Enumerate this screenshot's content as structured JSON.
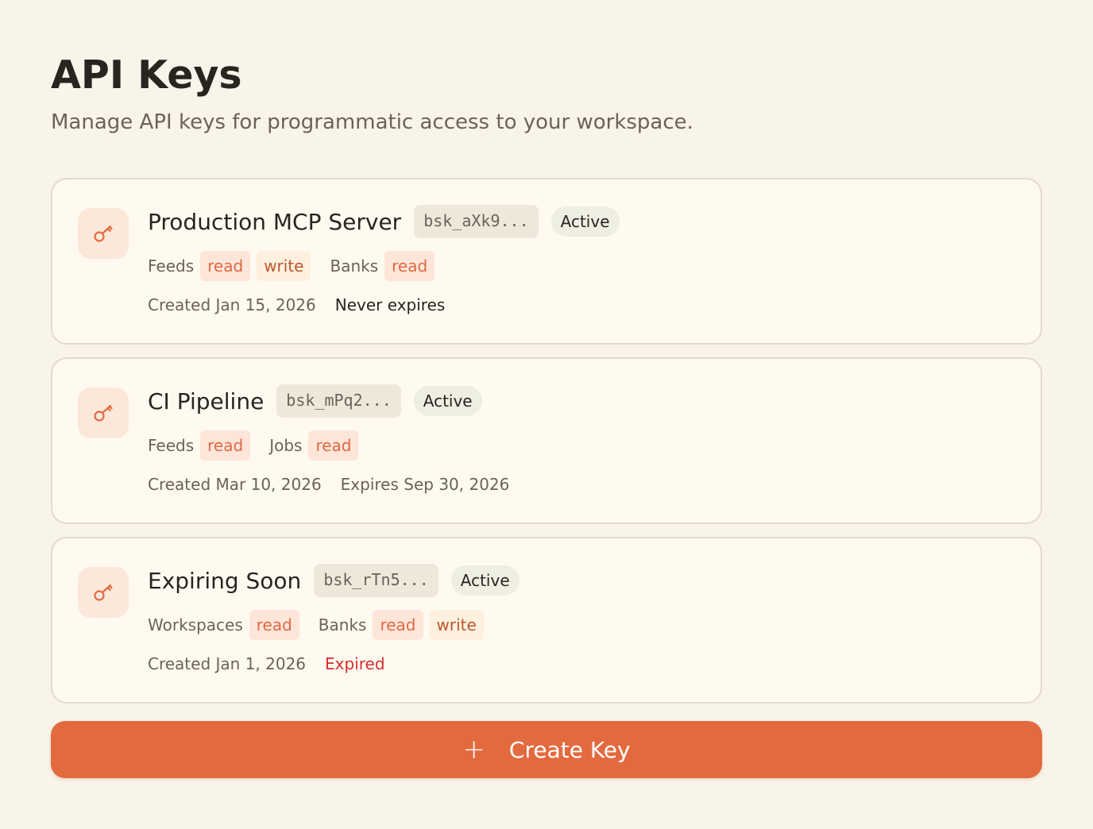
{
  "header": {
    "title": "API Keys",
    "subtitle": "Manage API keys for programmatic access to your workspace."
  },
  "keys": [
    {
      "name": "Production MCP Server",
      "prefix": "bsk_aXk9...",
      "status": "Active",
      "scopes": [
        {
          "label": "Feeds",
          "perms": [
            "read",
            "write"
          ]
        },
        {
          "label": "Banks",
          "perms": [
            "read"
          ]
        }
      ],
      "created": "Created Jan 15, 2026",
      "expiry": "Never expires",
      "expiry_state": "never"
    },
    {
      "name": "CI Pipeline",
      "prefix": "bsk_mPq2...",
      "status": "Active",
      "scopes": [
        {
          "label": "Feeds",
          "perms": [
            "read"
          ]
        },
        {
          "label": "Jobs",
          "perms": [
            "read"
          ]
        }
      ],
      "created": "Created Mar 10, 2026",
      "expiry": "Expires Sep 30, 2026",
      "expiry_state": "date"
    },
    {
      "name": "Expiring Soon",
      "prefix": "bsk_rTn5...",
      "status": "Active",
      "scopes": [
        {
          "label": "Workspaces",
          "perms": [
            "read"
          ]
        },
        {
          "label": "Banks",
          "perms": [
            "read",
            "write"
          ]
        }
      ],
      "created": "Created Jan 1, 2026",
      "expiry": "Expired",
      "expiry_state": "expired"
    }
  ],
  "create_button": {
    "icon": "plus-icon",
    "label": "Create Key"
  },
  "colors": {
    "background": "#f9f4ea",
    "accent": "#e36a3f",
    "expired": "#d62d2d"
  }
}
